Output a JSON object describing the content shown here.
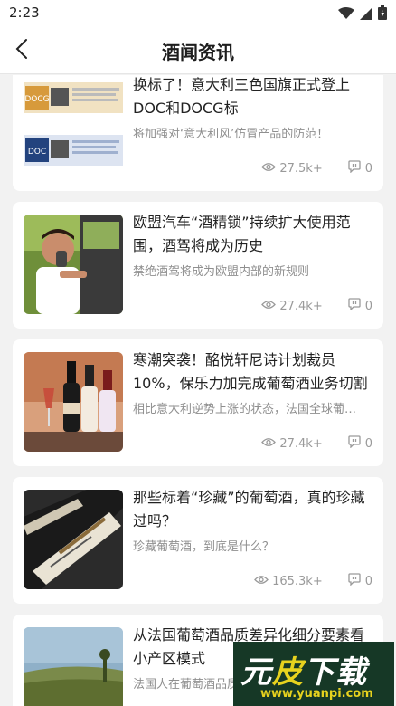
{
  "status_bar": {
    "time": "2:23",
    "icons": [
      "wifi-icon",
      "signal-icon",
      "battery-icon"
    ]
  },
  "header": {
    "back_icon": "chevron-left-icon",
    "title": "酒闻资讯"
  },
  "articles": [
    {
      "title": "换标了！意大利三色国旗正式登上DOC和DOCG标",
      "summary": "将加强对‘意大利风’仿冒产品的防范！",
      "views": "27.5k+",
      "comments": "0",
      "thumb_labels": [
        "DOCG",
        "DOC"
      ]
    },
    {
      "title": "欧盟汽车“酒精锁”持续扩大使用范围，酒驾将成为历史",
      "summary": "禁绝酒驾将成为欧盟内部的新规则",
      "views": "27.4k+",
      "comments": "0"
    },
    {
      "title": "寒潮突袭！酩悦轩尼诗计划裁员10%，保乐力加完成葡萄酒业务切割",
      "summary": "相比意大利逆势上涨的状态，法国全球葡…",
      "views": "27.4k+",
      "comments": "0"
    },
    {
      "title": "那些标着“珍藏”的葡萄酒，真的珍藏过吗？",
      "summary": "珍藏葡萄酒，到底是什么？",
      "views": "165.3k+",
      "comments": "0"
    },
    {
      "title": "从法国葡萄酒品质差异化细分要素看小产区模式",
      "summary": "法国人在葡萄酒品质",
      "views": "",
      "comments": ""
    }
  ],
  "watermark": {
    "main": "元皮下载",
    "main_a": "元",
    "main_b": "皮",
    "main_c": "下载",
    "url": "www.yuanpi.com"
  },
  "colors": {
    "background": "#f2f2f2",
    "card": "#ffffff",
    "meta_text": "#9a9a9a",
    "watermark_bg": "#163826",
    "watermark_accent": "#e7d21e"
  }
}
